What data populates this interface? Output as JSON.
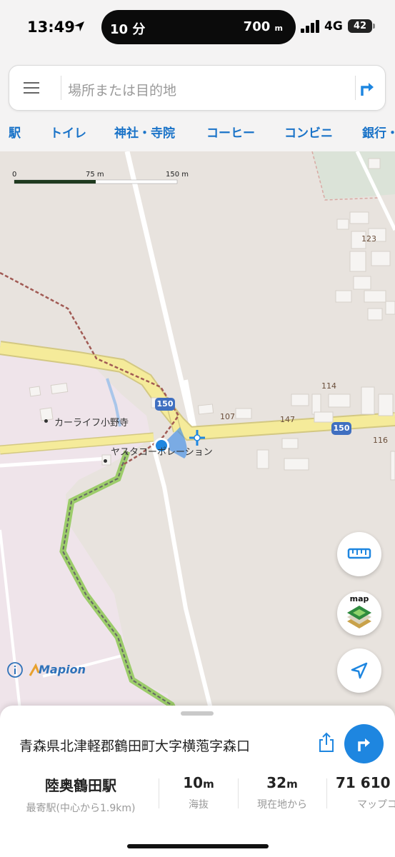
{
  "status_bar": {
    "time": "13:49",
    "island_left": "10 分",
    "island_right_value": "700",
    "island_right_unit": "m",
    "network": "4G",
    "battery": "42"
  },
  "search": {
    "placeholder": "場所または目的地"
  },
  "categories": [
    "駅",
    "トイレ",
    "神社・寺院",
    "コーヒー",
    "コンビニ",
    "銀行・"
  ],
  "map": {
    "scale": {
      "zero": "0",
      "mid": "75 m",
      "end": "150 m"
    },
    "labels": {
      "poi_1": "カーライフ小野寺",
      "poi_2": "ヤスタコーポレーション"
    },
    "house_numbers": [
      "123",
      "114",
      "107",
      "147",
      "116"
    ],
    "route_shields": [
      "150",
      "150"
    ],
    "layers_button_label": "map",
    "brand": "Mapion"
  },
  "sheet": {
    "address": "青森県北津軽郡鶴田町大字横萢字森口",
    "stats": [
      {
        "value": "陸奥鶴田駅",
        "unit": "",
        "label": "最寄駅(中心から1.9km)"
      },
      {
        "value": "10",
        "unit": "m",
        "label": "海抜"
      },
      {
        "value": "32",
        "unit": "m",
        "label": "現在地から"
      },
      {
        "value": "71 610",
        "unit": "",
        "label": "マップコ"
      }
    ]
  },
  "colors": {
    "accent": "#1e86e0",
    "category_text": "#1a73c8",
    "road_yellow": "#f5eb9a",
    "route_green": "#9ccc6a",
    "land_pink": "#efe4ea",
    "land_beige": "#e8e3de"
  }
}
